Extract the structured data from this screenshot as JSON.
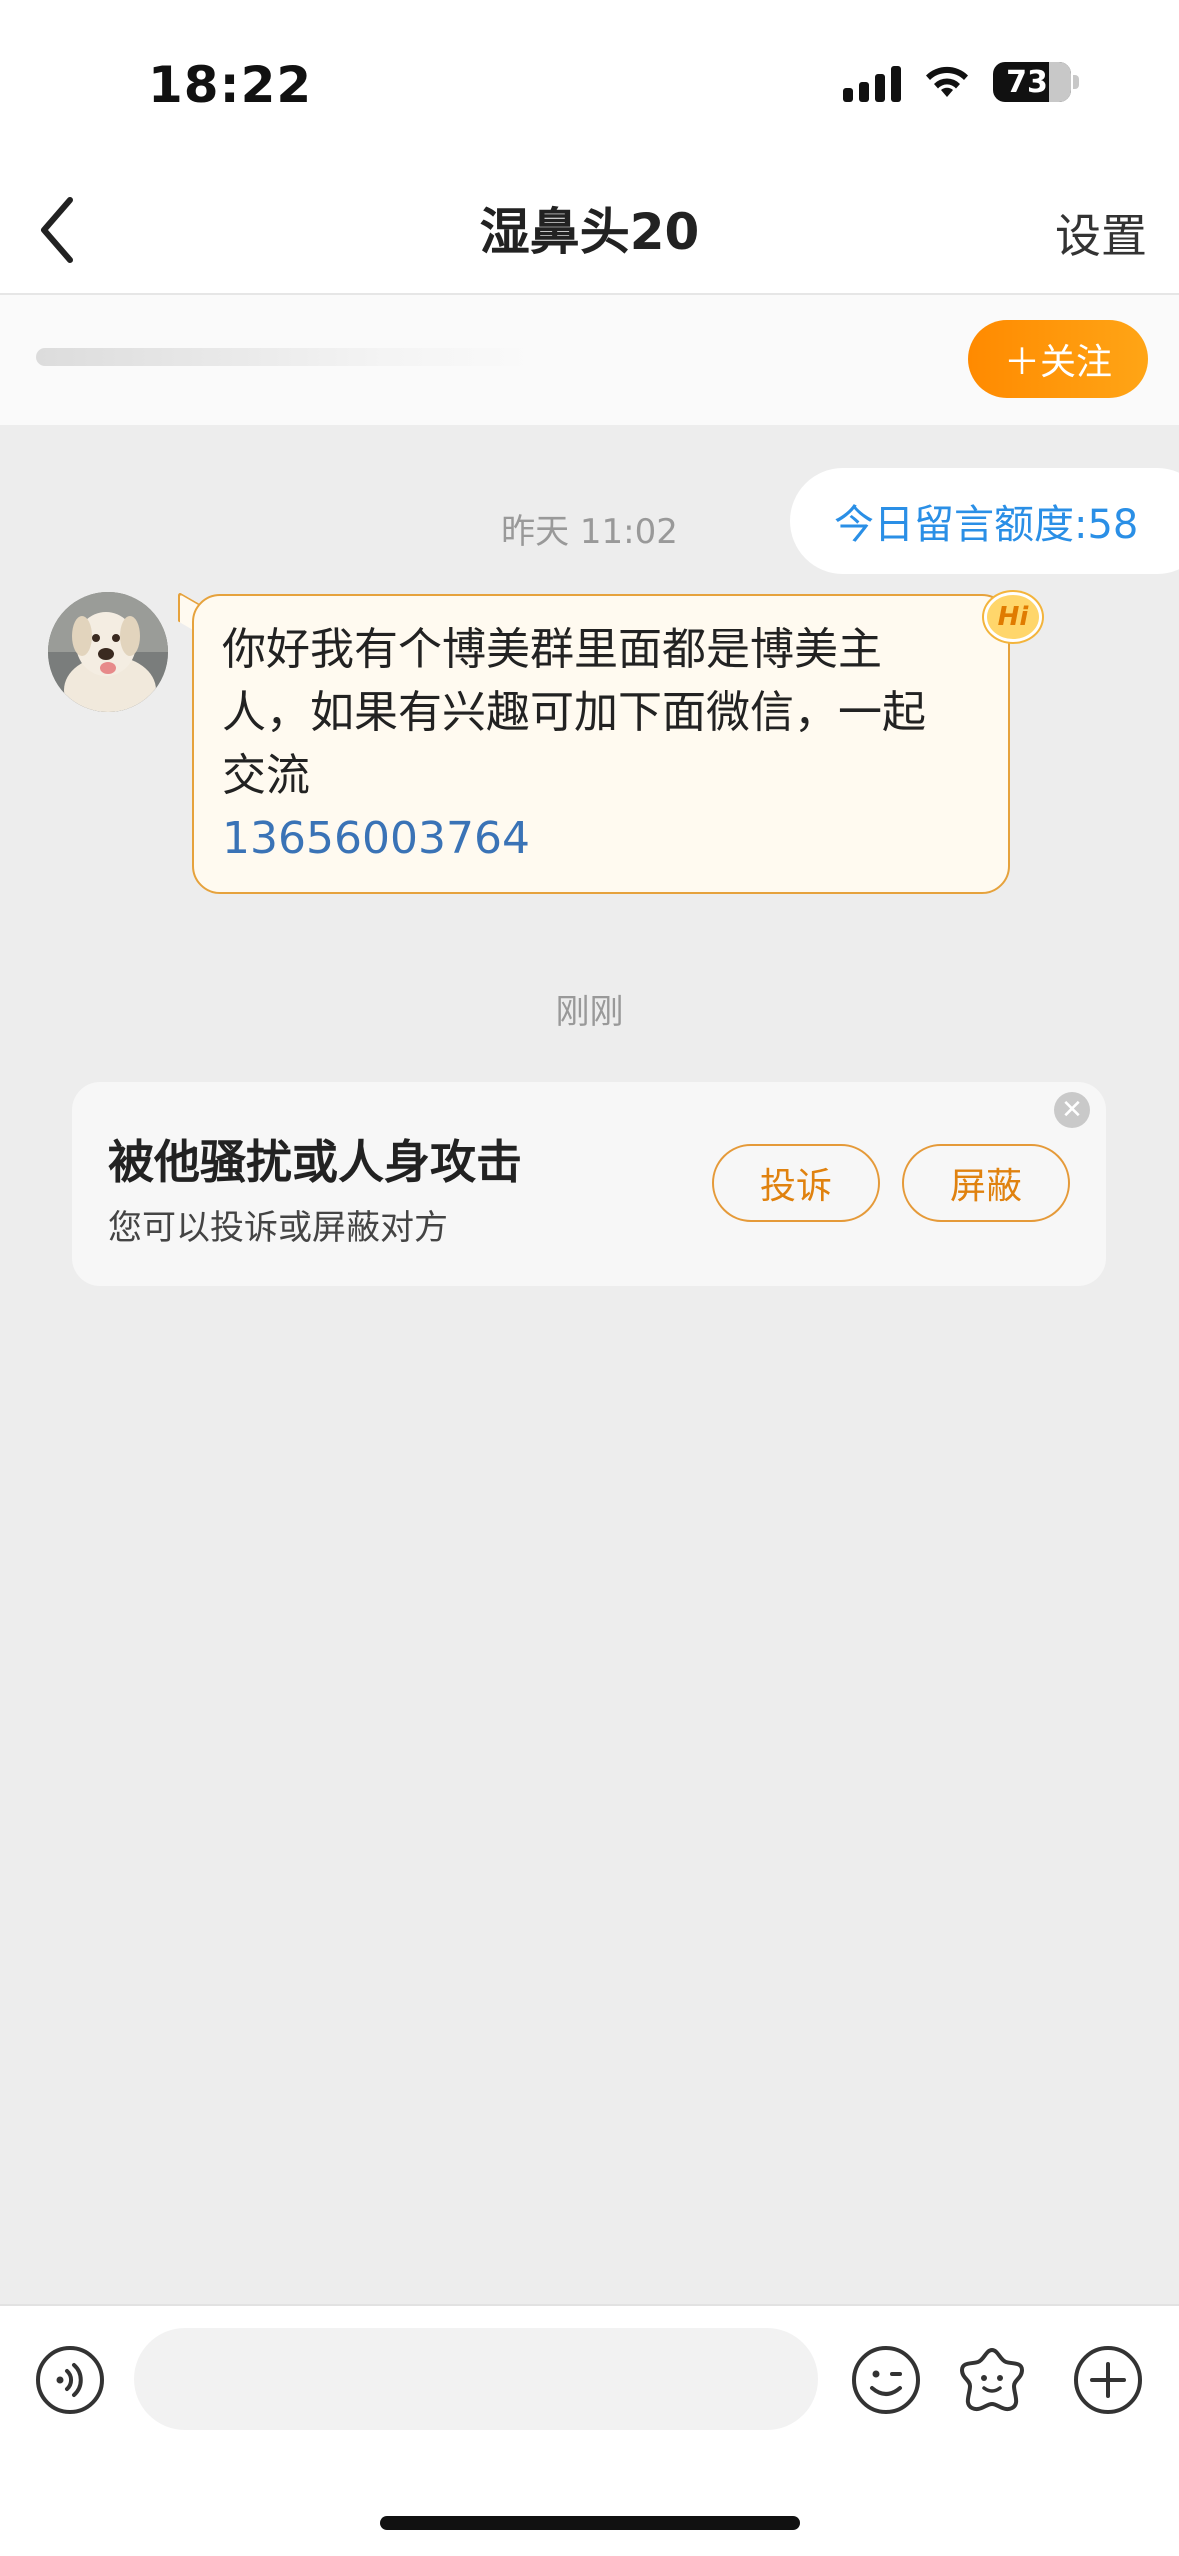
{
  "status_bar": {
    "time": "18:22",
    "battery": "73",
    "icons": [
      "signal-icon",
      "wifi-icon",
      "battery-icon"
    ]
  },
  "nav": {
    "back_icon": "chevron-left-icon",
    "title": "湿鼻头20",
    "settings_label": "设置"
  },
  "follow_bar": {
    "follow_label": "＋关注"
  },
  "chat": {
    "quota_label": "今日留言额度:58",
    "timestamp_1": "昨天 11:02",
    "message": {
      "text": "你好我有个博美群里面都是博美主人，如果有兴趣可加下面微信，一起交流",
      "phone": "13656003764",
      "badge": "Hi"
    },
    "timestamp_2": "刚刚"
  },
  "report_card": {
    "title": "被他骚扰或人身攻击",
    "subtitle": "您可以投诉或屏蔽对方",
    "complain_label": "投诉",
    "block_label": "屏蔽",
    "close_icon": "close-icon"
  },
  "input_bar": {
    "icons": [
      "voice-icon",
      "emoji-icon",
      "sticker-icon",
      "plus-icon"
    ],
    "placeholder": ""
  },
  "colors": {
    "accent_orange": "#ff8a00",
    "link_blue": "#2a8fe6",
    "bubble_border": "#e6a23c",
    "background": "#ededed"
  }
}
